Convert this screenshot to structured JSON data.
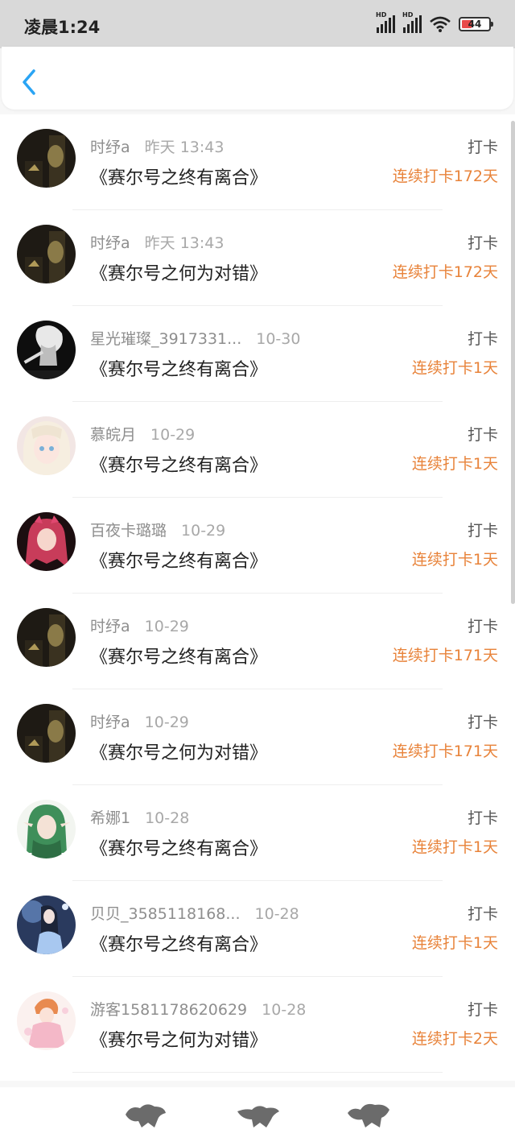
{
  "status_bar": {
    "time": "凌晨1:24",
    "signal_1": "HD",
    "signal_2": "HD",
    "battery": "44"
  },
  "header": {
    "back_icon": "chevron-left-icon"
  },
  "colors": {
    "accent": "#2aa4f4",
    "streak": "#e8833a",
    "battery_low": "#e84a4a"
  },
  "items": [
    {
      "user": "时纾a",
      "time": "昨天 13:43",
      "title": "《赛尔号之终有离合》",
      "action": "打卡",
      "streak": "连续打卡172天",
      "avatar": "avatar-dark-bell"
    },
    {
      "user": "时纾a",
      "time": "昨天 13:43",
      "title": "《赛尔号之何为对错》",
      "action": "打卡",
      "streak": "连续打卡172天",
      "avatar": "avatar-dark-bell"
    },
    {
      "user": "星光璀璨_3917331...",
      "time": "10-30",
      "title": "《赛尔号之终有离合》",
      "action": "打卡",
      "streak": "连续打卡1天",
      "avatar": "avatar-white-hair"
    },
    {
      "user": "慕皖月",
      "time": "10-29",
      "title": "《赛尔号之终有离合》",
      "action": "打卡",
      "streak": "连续打卡1天",
      "avatar": "avatar-pastel-girl"
    },
    {
      "user": "百夜卡璐璐",
      "time": "10-29",
      "title": "《赛尔号之终有离合》",
      "action": "打卡",
      "streak": "连续打卡1天",
      "avatar": "avatar-pink-hair"
    },
    {
      "user": "时纾a",
      "time": "10-29",
      "title": "《赛尔号之终有离合》",
      "action": "打卡",
      "streak": "连续打卡171天",
      "avatar": "avatar-dark-bell"
    },
    {
      "user": "时纾a",
      "time": "10-29",
      "title": "《赛尔号之何为对错》",
      "action": "打卡",
      "streak": "连续打卡171天",
      "avatar": "avatar-dark-bell"
    },
    {
      "user": "希娜1",
      "time": "10-28",
      "title": "《赛尔号之终有离合》",
      "action": "打卡",
      "streak": "连续打卡1天",
      "avatar": "avatar-green-elf"
    },
    {
      "user": "贝贝_3585118168...",
      "time": "10-28",
      "title": "《赛尔号之终有离合》",
      "action": "打卡",
      "streak": "连续打卡1天",
      "avatar": "avatar-blue-fantasy"
    },
    {
      "user": "游客1581178620629",
      "time": "10-28",
      "title": "《赛尔号之何为对错》",
      "action": "打卡",
      "streak": "连续打卡2天",
      "avatar": "avatar-orange-fairy"
    }
  ]
}
